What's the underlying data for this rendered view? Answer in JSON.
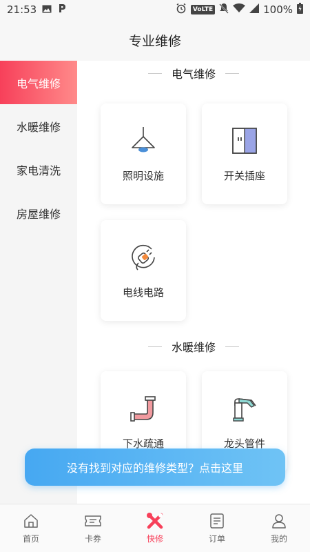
{
  "status_bar": {
    "time": "21:53",
    "battery": "100%",
    "network_badge": "VoLTE"
  },
  "header": {
    "title": "专业维修"
  },
  "sidebar": {
    "items": [
      {
        "label": "电气维修",
        "active": true
      },
      {
        "label": "水暖维修",
        "active": false
      },
      {
        "label": "家电清洗",
        "active": false
      },
      {
        "label": "房屋维修",
        "active": false
      }
    ]
  },
  "sections": [
    {
      "title": "电气维修",
      "items": [
        {
          "label": "照明设施",
          "icon": "ceiling-lamp-icon"
        },
        {
          "label": "开关插座",
          "icon": "switch-socket-icon"
        },
        {
          "label": "电线电路",
          "icon": "plug-wire-icon"
        }
      ]
    },
    {
      "title": "水暖维修",
      "items": [
        {
          "label": "下水疏通",
          "icon": "drain-pipe-icon"
        },
        {
          "label": "龙头管件",
          "icon": "faucet-icon"
        }
      ]
    }
  ],
  "help_banner": {
    "text": "没有找到对应的维修类型？点击这里"
  },
  "tabbar": {
    "items": [
      {
        "label": "首页",
        "icon": "home-icon",
        "active": false
      },
      {
        "label": "卡券",
        "icon": "ticket-icon",
        "active": false
      },
      {
        "label": "快修",
        "icon": "tools-icon",
        "active": true
      },
      {
        "label": "订单",
        "icon": "order-icon",
        "active": false
      },
      {
        "label": "我的",
        "icon": "profile-icon",
        "active": false
      }
    ]
  },
  "colors": {
    "accent_red": "#f7405a",
    "banner_blue": "#46a8f2",
    "tab_active": "#f7405a"
  }
}
